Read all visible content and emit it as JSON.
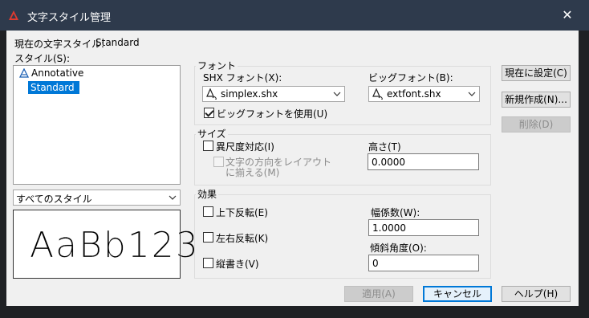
{
  "window": {
    "title": "文字スタイル管理",
    "close_glyph": "✕"
  },
  "current_style": {
    "label": "現在の文字スタイル:",
    "value": "Standard"
  },
  "styles": {
    "label": "スタイル(S):",
    "items": [
      {
        "label": "Annotative",
        "icon": "annotative-icon"
      },
      {
        "label": "Standard",
        "selected": true
      }
    ],
    "filter_value": "すべてのスタイル"
  },
  "preview": {
    "text": "AaBb123"
  },
  "font_group": {
    "title": "フォント",
    "shx_label": "SHX フォント(X):",
    "shx_value": "simplex.shx",
    "big_label": "ビッグフォント(B):",
    "big_value": "extfont.shx",
    "use_big_label": "ビッグフォントを使用(U)",
    "use_big_checked": true
  },
  "size_group": {
    "title": "サイズ",
    "annotative_label": "異尺度対応(I)",
    "match_layout_label_1": "文字の方向をレイアウト",
    "match_layout_label_2": "に揃える(M)",
    "height_label": "高さ(T)",
    "height_value": "0.0000"
  },
  "effects_group": {
    "title": "効果",
    "upside_down_label": "上下反転(E)",
    "backwards_label": "左右反転(K)",
    "vertical_label": "縦書き(V)",
    "width_factor_label": "幅係数(W):",
    "width_factor_value": "1.0000",
    "oblique_label": "傾斜角度(O):",
    "oblique_value": "0"
  },
  "buttons": {
    "set_current": "現在に設定(C)",
    "new": "新規作成(N)...",
    "delete": "削除(D)",
    "apply": "適用(A)",
    "cancel": "キャンセル",
    "help": "ヘルプ(H)"
  },
  "colors": {
    "titlebar": "#2e3a4c",
    "selection": "#0078d7",
    "dialog_bg": "#f0f0f0"
  }
}
